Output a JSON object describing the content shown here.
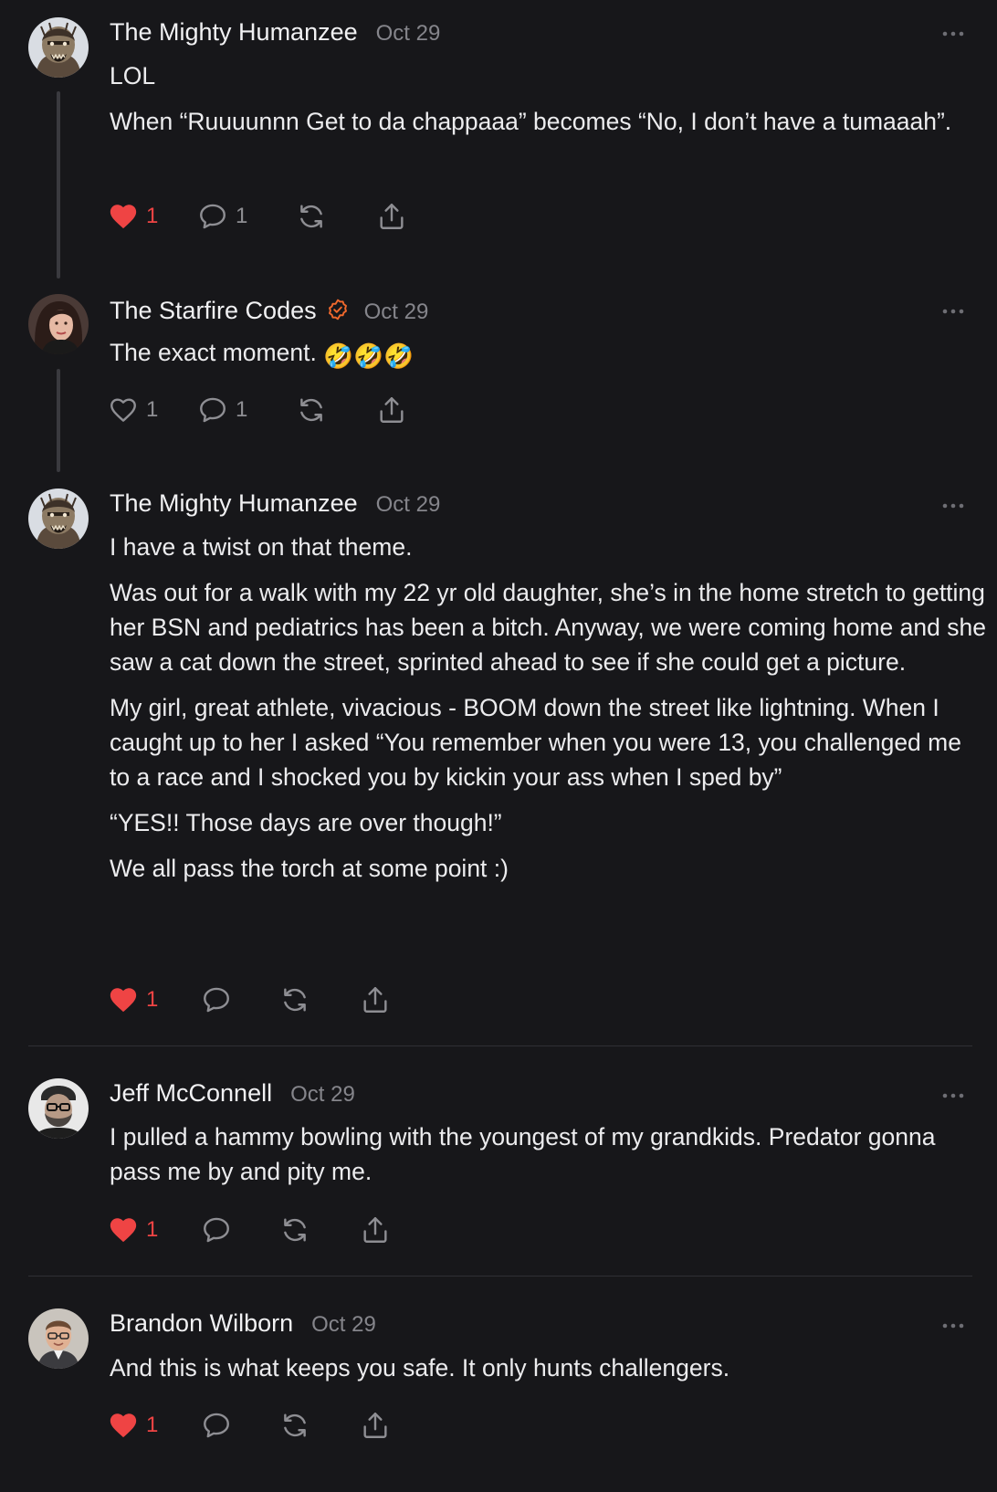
{
  "colors": {
    "background": "#17171a",
    "like_active": "#ef4444",
    "verified_badge": "#f0682c",
    "muted_text": "#85858b"
  },
  "icons": {
    "like": "heart-icon",
    "reply": "speech-bubble-icon",
    "restack": "refresh-arrows-icon",
    "share": "share-upload-icon",
    "more": "ellipsis-icon",
    "verified": "verified-badge-icon"
  },
  "comments": [
    {
      "author": "The Mighty Humanzee",
      "date": "Oct 29",
      "paragraphs": [
        "LOL",
        "When “Ruuuunnn Get to da chappaaa” becomes “No, I don’t have a tumaaah”."
      ],
      "likes": "1",
      "liked": true,
      "replies": "1"
    },
    {
      "author": "The Starfire Codes",
      "verified": true,
      "date": "Oct 29",
      "paragraphs": [
        "The exact moment. "
      ],
      "emoji": "🤣🤣🤣",
      "likes": "1",
      "liked": false,
      "replies": "1"
    },
    {
      "author": "The Mighty Humanzee",
      "date": "Oct 29",
      "paragraphs": [
        "I have a twist on that theme.",
        "Was out for a walk with my 22 yr old daughter, she’s in the home stretch to getting her BSN and pediatrics has been a bitch. Anyway, we were coming home and she saw a cat down the street, sprinted ahead to see if she could get a picture.",
        "My girl, great athlete, vivacious - BOOM down the street like lightning. When I caught up to her I asked “You remember when you were 13, you challenged me to a race and I shocked you by kickin your ass when I sped by”",
        "“YES!! Those days are over though!”",
        "We all pass the torch at some point :)"
      ],
      "likes": "1",
      "liked": true
    },
    {
      "author": "Jeff McConnell",
      "date": "Oct 29",
      "paragraphs": [
        "I pulled a hammy bowling with the youngest of my grandkids. Predator gonna pass me by and pity me."
      ],
      "likes": "1",
      "liked": true
    },
    {
      "author": "Brandon Wilborn",
      "date": "Oct 29",
      "paragraphs": [
        "And this is what keeps you safe. It only hunts challengers."
      ],
      "likes": "1",
      "liked": true
    }
  ]
}
